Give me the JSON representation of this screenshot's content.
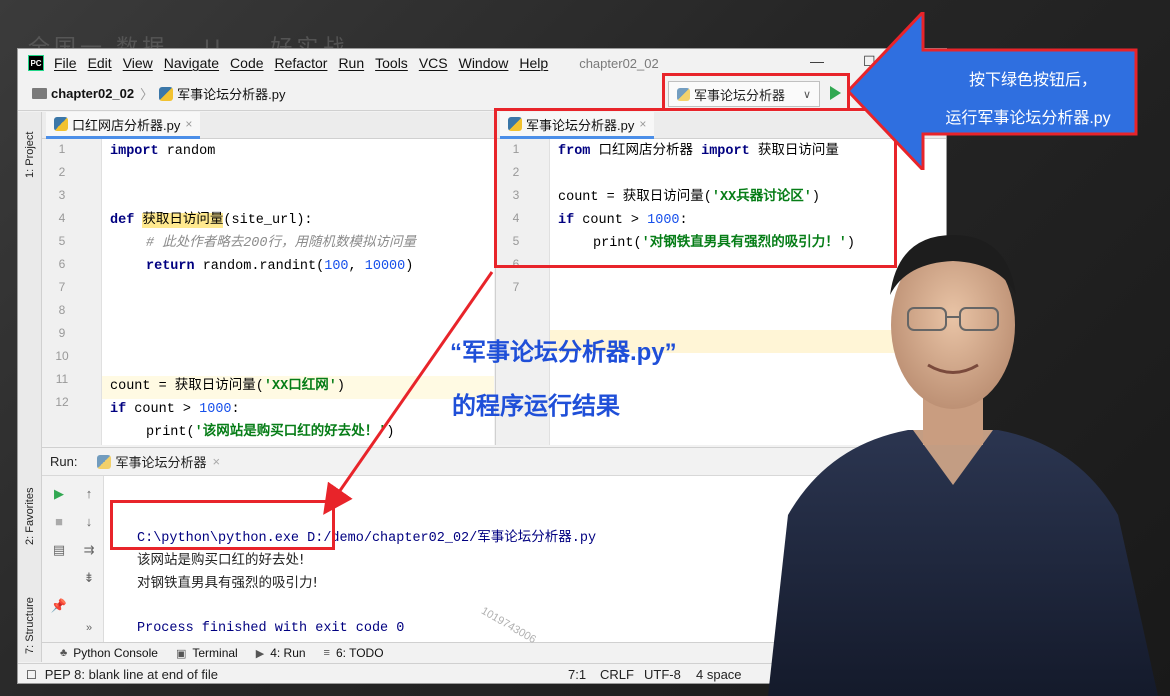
{
  "menu": {
    "items": [
      "File",
      "Edit",
      "View",
      "Navigate",
      "Code",
      "Refactor",
      "Run",
      "Tools",
      "VCS",
      "Window",
      "Help"
    ],
    "window_title": "chapter02_02",
    "minimize": "—",
    "maximize": "☐"
  },
  "navbar": {
    "project": "chapter02_02",
    "file": "军事论坛分析器.py",
    "run_config": "军事论坛分析器"
  },
  "sidebar": {
    "project_tab": "1: Project",
    "favorites_tab": "2: Favorites",
    "structure_tab": "7: Structure"
  },
  "left_editor": {
    "tab": "口红网店分析器.py",
    "line_numbers": [
      "1",
      "2",
      "3",
      "4",
      "5",
      "6",
      "7",
      "8",
      "9",
      "10",
      "11",
      "12"
    ],
    "code": {
      "l1_kw": "import",
      "l1_rest": " random",
      "l4_kw": "def ",
      "l4_fn": "获取日访问量",
      "l4_rest": "(site_url):",
      "l5_comment": "# 此处作者略去200行，用随机数模拟访问量",
      "l6_kw": "return",
      "l6_a": " random.randint(",
      "l6_n1": "100",
      "l6_b": ", ",
      "l6_n2": "10000",
      "l6_c": ")",
      "l9_a": "count = 获取日访问量(",
      "l9_str": "'XX口红网'",
      "l9_b": ")",
      "l10_kw": "if",
      "l10_a": " count > ",
      "l10_num": "1000",
      "l10_b": ":",
      "l11_a": "print(",
      "l11_str": "'该网站是购买口红的好去处！'",
      "l11_b": ")"
    }
  },
  "right_editor": {
    "tab": "军事论坛分析器.py",
    "line_numbers": [
      "1",
      "2",
      "3",
      "4",
      "5",
      "6",
      "7"
    ],
    "code": {
      "l1_kw1": "from",
      "l1_mod": " 口红网店分析器 ",
      "l1_kw2": "import",
      "l1_name": " 获取日访问量",
      "l3_a": "count = 获取日访问量(",
      "l3_str": "'XX兵器讨论区'",
      "l3_b": ")",
      "l4_kw": "if",
      "l4_a": " count > ",
      "l4_num": "1000",
      "l4_b": ":",
      "l5_a": "print(",
      "l5_str": "'对钢铁直男具有强烈的吸引力！'",
      "l5_b": ")"
    }
  },
  "run_panel": {
    "label": "Run:",
    "config": "军事论坛分析器",
    "command": "C:\\python\\python.exe D:/demo/chapter02_02/军事论坛分析器.py",
    "output_line1": "该网站是购买口红的好去处!",
    "output_line2": "对钢铁直男具有强烈的吸引力!",
    "exit_message": "Process finished with exit code 0"
  },
  "bottom_tools": {
    "python_console": "Python Console",
    "terminal": "Terminal",
    "run": "4: Run",
    "todo": "6: TODO"
  },
  "status": {
    "message": "PEP 8: blank line at end of file",
    "position": "7:1",
    "line_sep": "CRLF",
    "encoding": "UTF-8",
    "indent": "4 space"
  },
  "overlay": {
    "callout_line1": "按下绿色按钮后，",
    "callout_line2": "运行军事论坛分析器.py",
    "result_line1": "“军事论坛分析器.py”",
    "result_line2": "的程序运行结果",
    "watermark": "1019743006",
    "ghost_title": "全国一 数据… U … 好实战"
  },
  "colors": {
    "annotation_red": "#e8242a",
    "callout_blue": "#2f6fe0",
    "caption_blue": "#1f4fd8",
    "run_green": "#32a852"
  }
}
